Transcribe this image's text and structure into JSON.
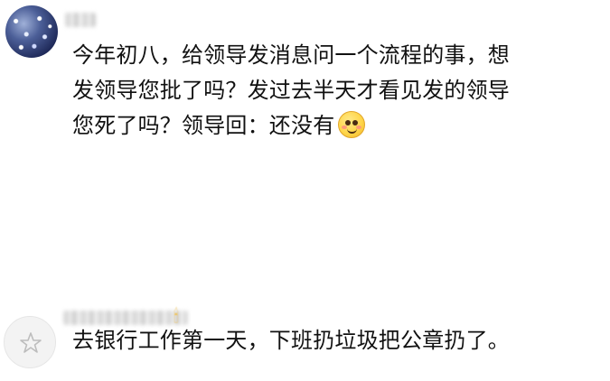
{
  "comments": [
    {
      "text_lines": [
        "今年初八，给领导发消息问一个流程的事，想",
        "发领导您批了吗？发过去半天才看见发的领导",
        "您死了吗？领导回：还没有"
      ],
      "emoji": "smiling-face-emoji"
    },
    {
      "text_lines": [
        "去银行工作第一天，下班扔垃圾把公章扔了。"
      ],
      "avatar_icon": "star-icon",
      "name_emoji": "candle-icon"
    }
  ]
}
